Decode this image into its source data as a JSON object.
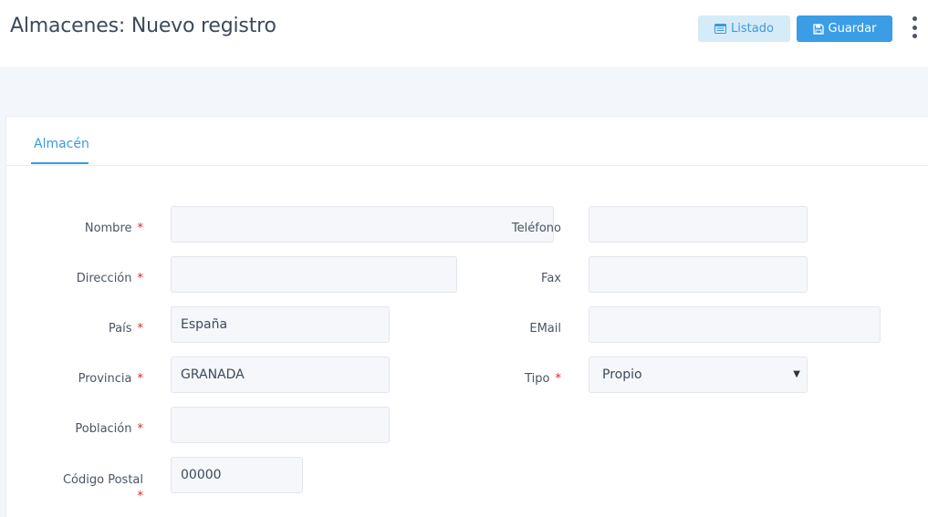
{
  "header": {
    "title": "Almacenes: Nuevo registro",
    "listado_label": "Listado",
    "guardar_label": "Guardar",
    "listado_icon": "list-window-icon",
    "guardar_icon": "floppy-disk-icon",
    "more_icon": "vertical-ellipsis-icon"
  },
  "tabs": [
    {
      "label": "Almacén",
      "active": true
    }
  ],
  "required_mark": "*",
  "form": {
    "nombre": {
      "label": "Nombre",
      "value": "",
      "required": true
    },
    "telefono": {
      "label": "Teléfono",
      "value": "",
      "required": false
    },
    "direccion": {
      "label": "Dirección",
      "value": "",
      "required": true
    },
    "fax": {
      "label": "Fax",
      "value": "",
      "required": false
    },
    "pais": {
      "label": "País",
      "value": "España",
      "required": true
    },
    "email": {
      "label": "EMail",
      "value": "",
      "required": false
    },
    "provincia": {
      "label": "Provincia",
      "value": "GRANADA",
      "required": true
    },
    "tipo": {
      "label": "Tipo",
      "value": "Propio",
      "required": true
    },
    "poblacion": {
      "label": "Población",
      "value": "",
      "required": true
    },
    "codigo_postal": {
      "label": "Código Postal",
      "value": "00000",
      "required": true
    }
  },
  "colors": {
    "accent": "#3a9ae0",
    "required": "#e02424",
    "band": "#f3f7fb",
    "field_bg": "#f5f7fa"
  }
}
